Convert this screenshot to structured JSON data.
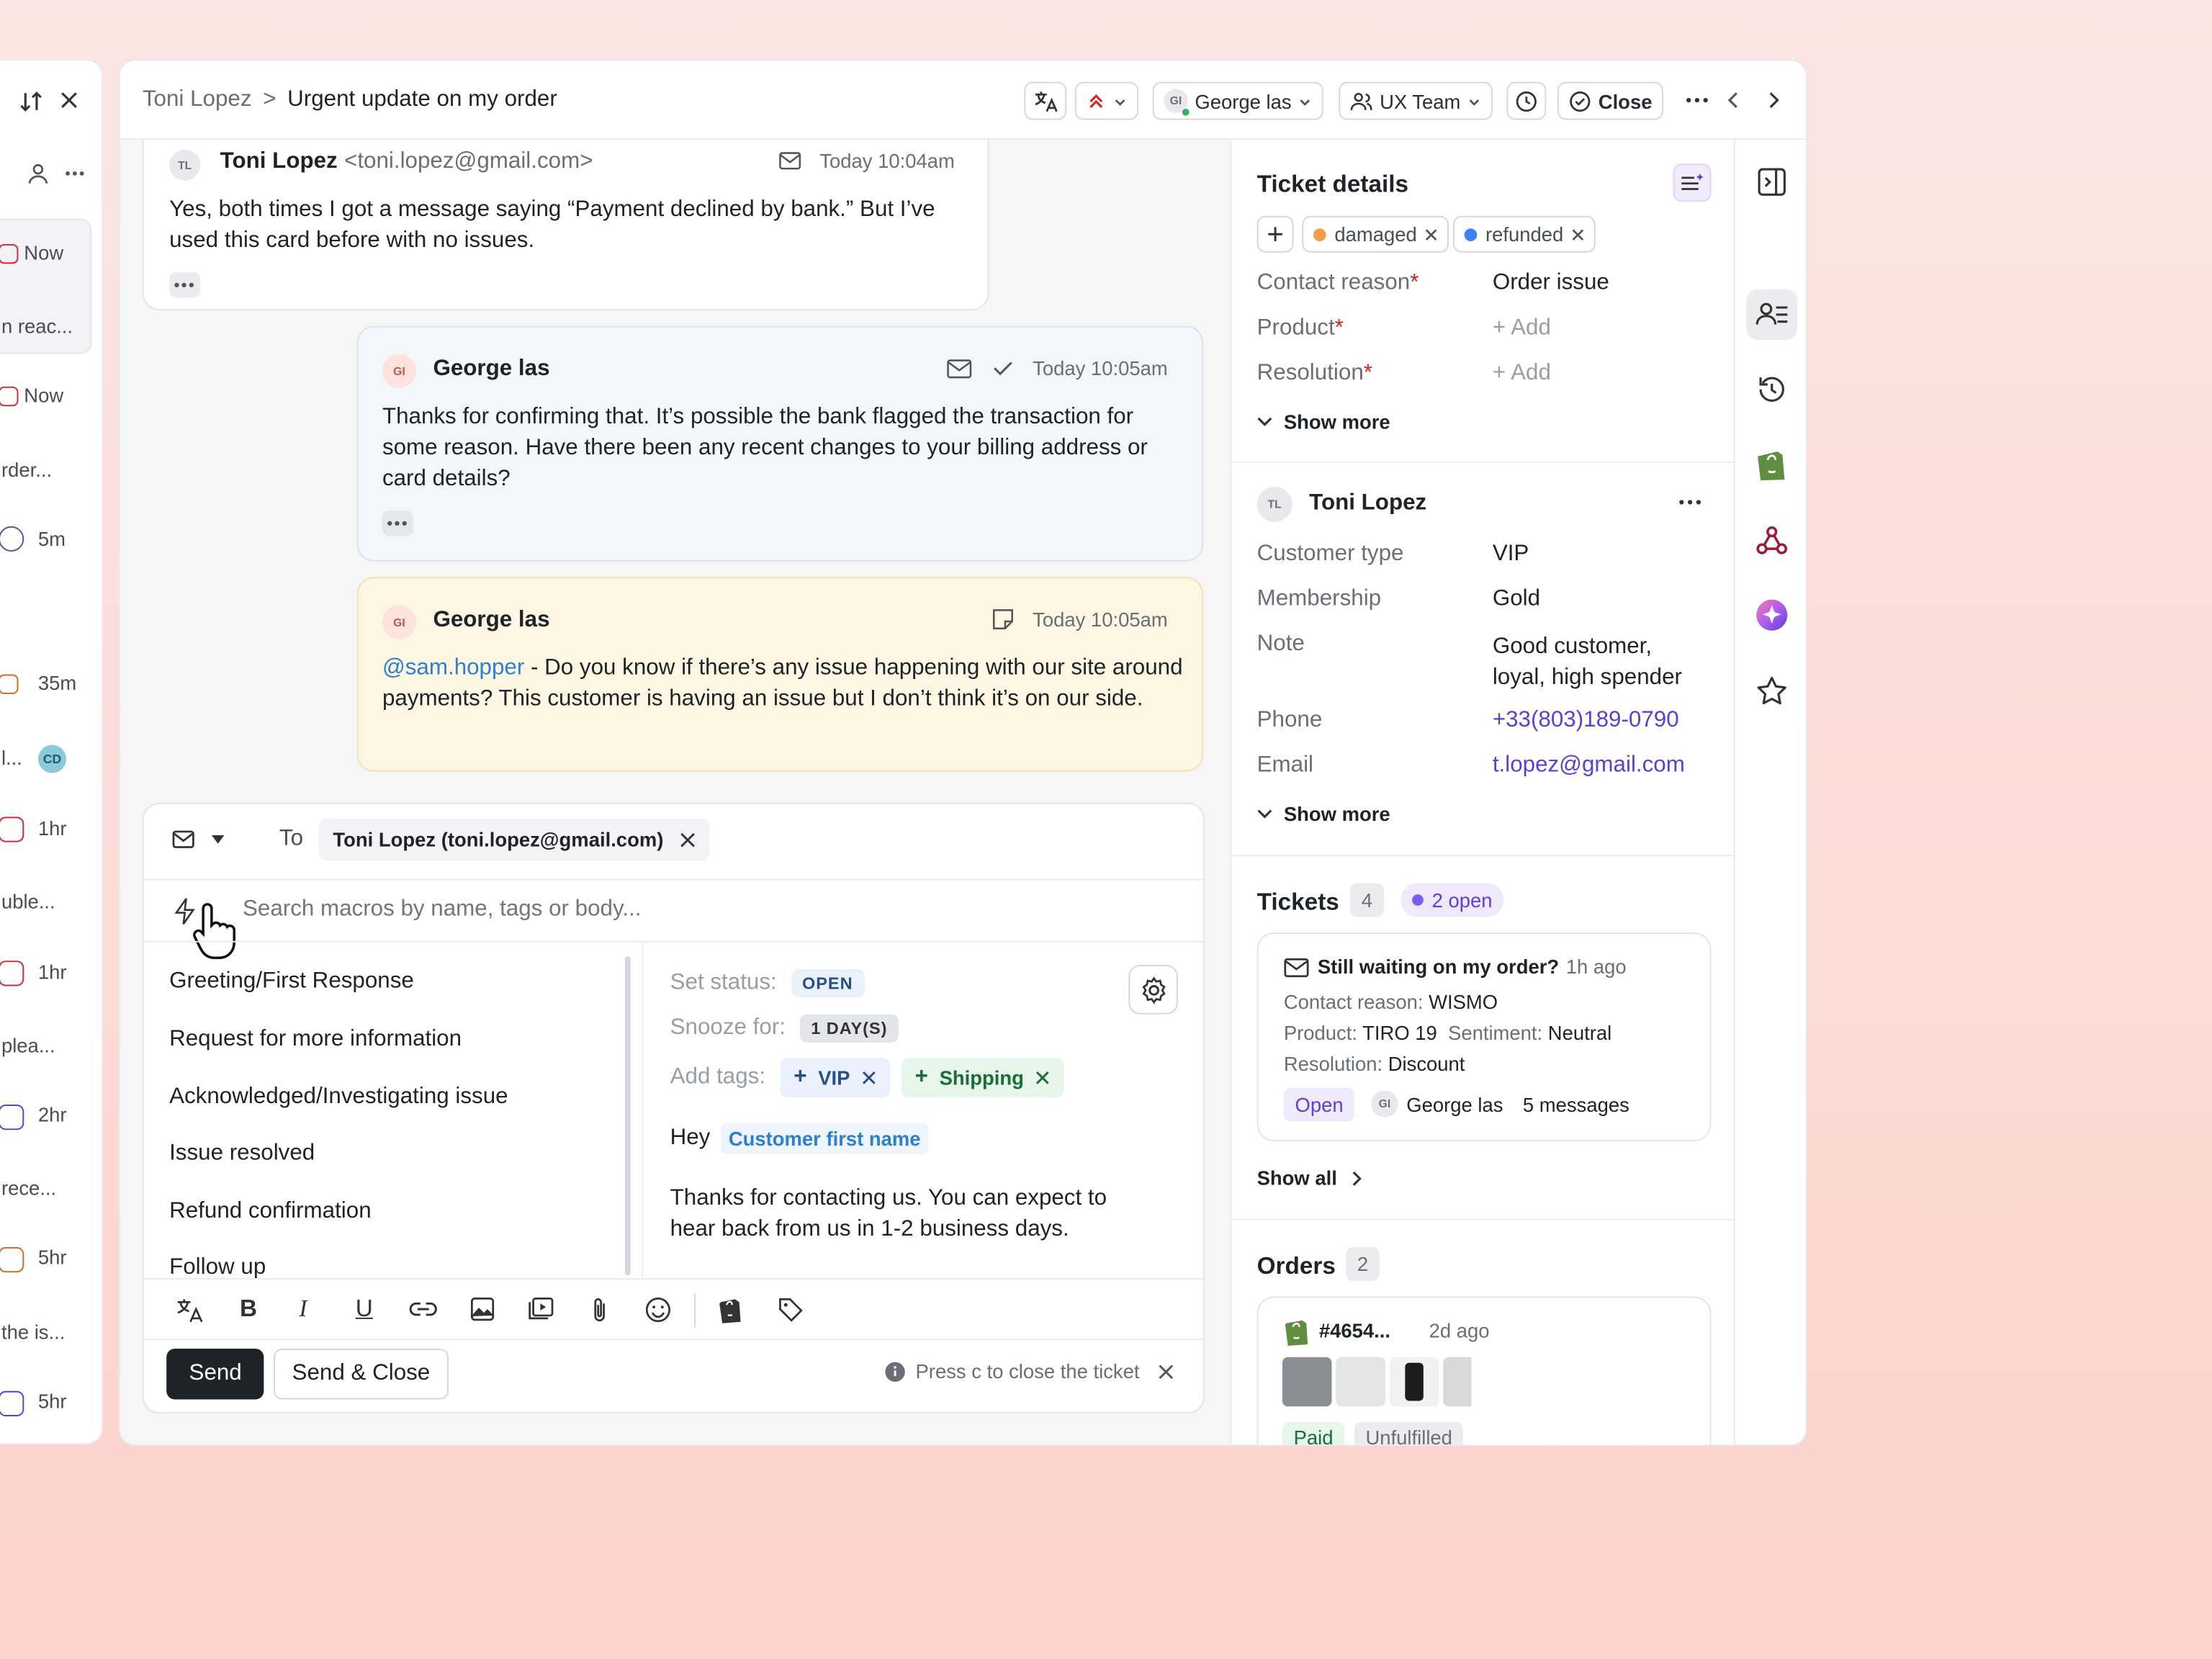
{
  "left_list": {
    "rows": [
      {
        "time": "Now",
        "snippet": ""
      },
      {
        "time": "",
        "snippet": "n reac..."
      },
      {
        "time": "Now",
        "snippet": ""
      },
      {
        "time": "",
        "snippet": "rder..."
      },
      {
        "time": "5m",
        "snippet": ""
      },
      {
        "time": "35m",
        "snippet": ""
      },
      {
        "time": "",
        "snippet": "l...",
        "badge": "CD"
      },
      {
        "time": "1hr",
        "snippet": ""
      },
      {
        "time": "",
        "snippet": "uble..."
      },
      {
        "time": "1hr",
        "snippet": ""
      },
      {
        "time": "",
        "snippet": "plea..."
      },
      {
        "time": "2hr",
        "snippet": ""
      },
      {
        "time": "",
        "snippet": "rece..."
      },
      {
        "time": "5hr",
        "snippet": ""
      },
      {
        "time": "",
        "snippet": "the is..."
      },
      {
        "time": "5hr",
        "snippet": ""
      }
    ]
  },
  "header": {
    "breadcrumb_parent": "Toni Lopez",
    "breadcrumb_sep": ">",
    "title": "Urgent update on my order",
    "assignee": "George las",
    "assignee_initials": "GI",
    "team": "UX Team",
    "close_label": "Close"
  },
  "messages": [
    {
      "initials": "TL",
      "author": "Toni Lopez",
      "email": "<toni.lopez@gmail.com>",
      "time": "Today 10:04am",
      "body": "Yes, both times I got a message saying “Payment declined by bank.” But I’ve used this card before with no issues."
    },
    {
      "initials": "GI",
      "author": "George las",
      "time": "Today 10:05am",
      "body": "Thanks for confirming that. It’s possible the bank flagged the transaction for some reason. Have there been any recent changes to your billing address or card details?"
    },
    {
      "initials": "GI",
      "author": "George las",
      "time": "Today 10:05am",
      "mention": "@sam.hopper",
      "body": " - Do you know if there’s any issue happening with our site around payments? This customer is having an issue but I don’t think it’s on our side."
    }
  ],
  "composer": {
    "to_label": "To",
    "recipient": "Toni Lopez (toni.lopez@gmail.com)",
    "search_placeholder": "Search macros by name, tags or body...",
    "macros": [
      "Greeting/First Response",
      "Request for more information",
      "Acknowledged/Investigating issue",
      "Issue resolved",
      "Refund confirmation",
      "Follow up"
    ],
    "preview": {
      "set_status_label": "Set status:",
      "status": "OPEN",
      "snooze_label": "Snooze for:",
      "snooze": "1 DAY(S)",
      "add_tags_label": "Add tags:",
      "tags": [
        "VIP",
        "Shipping"
      ],
      "greeting": "Hey",
      "variable": "Customer first name",
      "body": "Thanks for contacting us. You can expect to hear back from us in 1-2 business days."
    },
    "send_label": "Send",
    "send_close_label": "Send & Close",
    "hint": "Press c to close the ticket"
  },
  "ticket_details": {
    "title": "Ticket details",
    "tags": [
      {
        "label": "damaged",
        "color": "#f59a4a"
      },
      {
        "label": "refunded",
        "color": "#3b82f6"
      }
    ],
    "fields": [
      {
        "label": "Contact reason",
        "required": "*",
        "value": "Order issue",
        "empty": false
      },
      {
        "label": "Product",
        "required": "*",
        "value": "+ Add",
        "empty": true
      },
      {
        "label": "Resolution",
        "required": "*",
        "value": "+ Add",
        "empty": true
      }
    ],
    "show_more": "Show more"
  },
  "customer": {
    "initials": "TL",
    "name": "Toni Lopez",
    "fields": [
      {
        "label": "Customer type",
        "value": "VIP"
      },
      {
        "label": "Membership",
        "value": "Gold"
      },
      {
        "label": "Note",
        "value": "Good customer, loyal, high spender"
      },
      {
        "label": "Phone",
        "value": "+33(803)189-0790"
      },
      {
        "label": "Email",
        "value": "t.lopez@gmail.com"
      }
    ],
    "show_more": "Show more"
  },
  "tickets": {
    "title": "Tickets",
    "count": "4",
    "open_label": "2 open",
    "card": {
      "subject": "Still waiting on my order?",
      "age": "1h ago",
      "contact_reason_label": "Contact reason:",
      "contact_reason": "WISMO",
      "product_label": "Product:",
      "product": "TIRO 19",
      "sentiment_label": "Sentiment:",
      "sentiment": "Neutral",
      "resolution_label": "Resolution:",
      "resolution": "Discount",
      "status": "Open",
      "agent_initials": "GI",
      "agent": "George las",
      "messages": "5 messages"
    },
    "show_all": "Show all"
  },
  "orders": {
    "title": "Orders",
    "count": "2",
    "order_id": "#4654...",
    "age": "2d ago",
    "badges": [
      "Paid",
      "Unfulfilled"
    ]
  },
  "colors": {
    "accent": "#5b3fd6",
    "brand_shopify": "#5e8e3e",
    "note_bg": "#fdf6e3",
    "agent_msg_bg": "#f3f6fa"
  }
}
